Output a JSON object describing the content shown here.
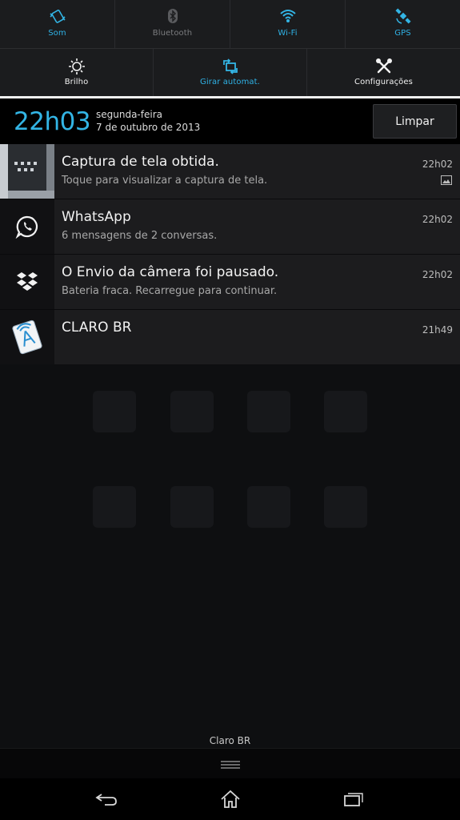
{
  "quick_settings": {
    "row1": [
      {
        "label": "Som",
        "icon": "sound-vibrate-icon",
        "state": "on"
      },
      {
        "label": "Bluetooth",
        "icon": "bluetooth-icon",
        "state": "off"
      },
      {
        "label": "Wi-Fi",
        "icon": "wifi-icon",
        "state": "on"
      },
      {
        "label": "GPS",
        "icon": "gps-satellite-icon",
        "state": "on"
      }
    ],
    "row2": [
      {
        "label": "Brilho",
        "icon": "brightness-icon",
        "state": "white"
      },
      {
        "label": "Girar automat.",
        "icon": "auto-rotate-icon",
        "state": "on"
      },
      {
        "label": "Configurações",
        "icon": "settings-tools-icon",
        "state": "white"
      }
    ]
  },
  "header": {
    "time": "22h03",
    "day": "segunda-feira",
    "date": "7 de outubro de 2013",
    "clear_label": "Limpar"
  },
  "notifications": [
    {
      "title": "Captura de tela obtida.",
      "text": "Toque para visualizar a captura de tela.",
      "time": "22h02",
      "icon": "screenshot-thumbnail"
    },
    {
      "title": "WhatsApp",
      "text": "6 mensagens de 2 conversas.",
      "time": "22h02",
      "icon": "whatsapp-icon"
    },
    {
      "title": "O Envio da câmera foi pausado.",
      "text": "Bateria fraca. Recarregue para continuar.",
      "time": "22h02",
      "icon": "dropbox-icon"
    },
    {
      "title": "CLARO BR",
      "text": "",
      "time": "21h49",
      "icon": "sim-card-icon"
    }
  ],
  "carrier_label": "Claro BR",
  "colors": {
    "accent": "#33b5e5",
    "background": "#0a0a0c"
  }
}
